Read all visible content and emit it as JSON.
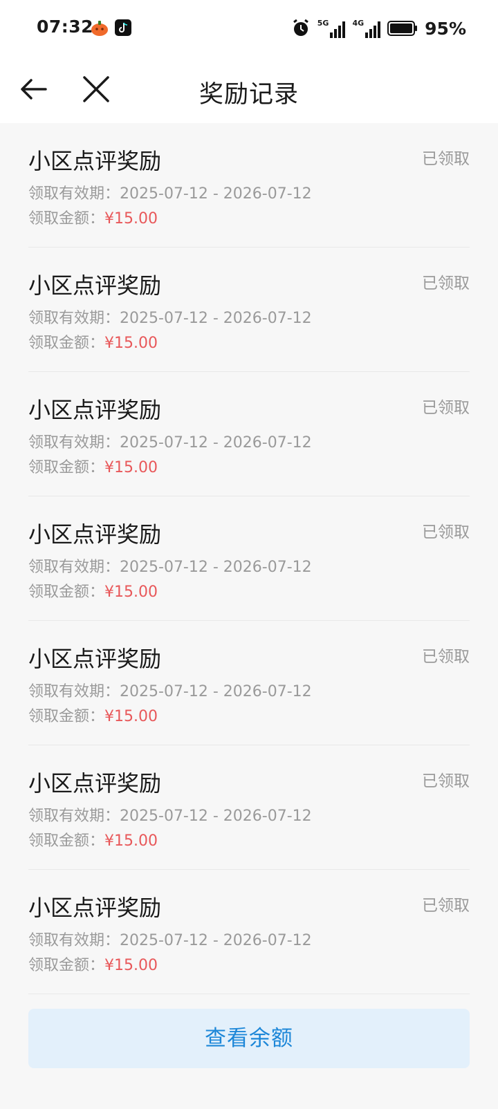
{
  "status_bar": {
    "time": "07:32",
    "network_1": "5G",
    "network_2": "4G",
    "battery": "95%"
  },
  "navbar": {
    "title": "奖励记录",
    "back_icon": "arrow-left-icon",
    "close_icon": "close-icon"
  },
  "records": [
    {
      "title": "小区点评奖励",
      "status": "已领取",
      "validity_label": "领取有效期：",
      "validity": "2025-07-12 - 2026-07-12",
      "amount_label": "领取金额：",
      "amount": "¥15.00"
    },
    {
      "title": "小区点评奖励",
      "status": "已领取",
      "validity_label": "领取有效期：",
      "validity": "2025-07-12 - 2026-07-12",
      "amount_label": "领取金额：",
      "amount": "¥15.00"
    },
    {
      "title": "小区点评奖励",
      "status": "已领取",
      "validity_label": "领取有效期：",
      "validity": "2025-07-12 - 2026-07-12",
      "amount_label": "领取金额：",
      "amount": "¥15.00"
    },
    {
      "title": "小区点评奖励",
      "status": "已领取",
      "validity_label": "领取有效期：",
      "validity": "2025-07-12 - 2026-07-12",
      "amount_label": "领取金额：",
      "amount": "¥15.00"
    },
    {
      "title": "小区点评奖励",
      "status": "已领取",
      "validity_label": "领取有效期：",
      "validity": "2025-07-12 - 2026-07-12",
      "amount_label": "领取金额：",
      "amount": "¥15.00"
    },
    {
      "title": "小区点评奖励",
      "status": "已领取",
      "validity_label": "领取有效期：",
      "validity": "2025-07-12 - 2026-07-12",
      "amount_label": "领取金额：",
      "amount": "¥15.00"
    },
    {
      "title": "小区点评奖励",
      "status": "已领取",
      "validity_label": "领取有效期：",
      "validity": "2025-07-12 - 2026-07-12",
      "amount_label": "领取金额：",
      "amount": "¥15.00"
    }
  ],
  "bottom_button": {
    "label": "查看余额"
  },
  "colors": {
    "accent": "#1d87d8",
    "amount": "#e8585a",
    "muted": "#9a9a9a",
    "button_bg": "#e3f0fb"
  }
}
